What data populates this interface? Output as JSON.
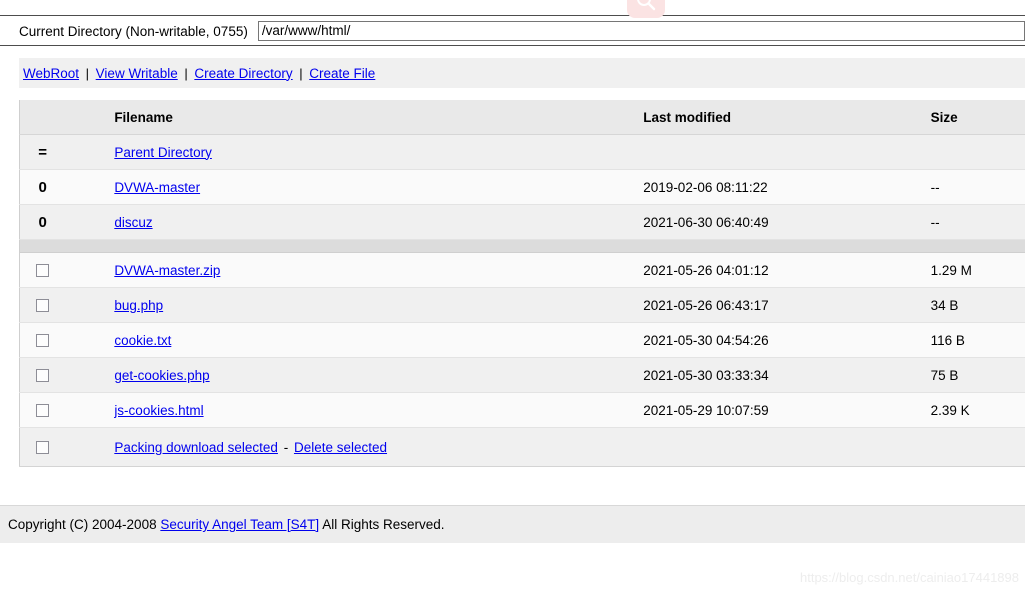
{
  "topbar": {
    "search_icon": "search-icon",
    "chip_color": "#fbe3e3"
  },
  "directory": {
    "label": "Current Directory (Non-writable, 0755)",
    "path_value": "/var/www/html/",
    "path_placeholder": "/var/www/html/"
  },
  "nav": {
    "links": [
      {
        "label": "WebRoot"
      },
      {
        "label": "View Writable"
      },
      {
        "label": "Create Directory"
      },
      {
        "label": "Create File"
      }
    ],
    "separator": "|"
  },
  "table": {
    "headers": {
      "icon": "",
      "filename": "Filename",
      "last_modified": "Last modified",
      "size": "Size"
    },
    "dir_rows": [
      {
        "icon": "=",
        "icon_name": "parent-directory-icon",
        "name": "Parent Directory",
        "last_modified": "",
        "size": ""
      },
      {
        "icon": "0",
        "icon_name": "folder-icon",
        "name": "DVWA-master",
        "last_modified": "2019-02-06 08:11:22",
        "size": "--"
      },
      {
        "icon": "0",
        "icon_name": "folder-icon",
        "name": "discuz",
        "last_modified": "2021-06-30 06:40:49",
        "size": "--"
      }
    ],
    "file_rows": [
      {
        "name": "DVWA-master.zip",
        "last_modified": "2021-05-26 04:01:12",
        "size": "1.29 M",
        "checked": false
      },
      {
        "name": "bug.php",
        "last_modified": "2021-05-26 06:43:17",
        "size": "34 B",
        "checked": false
      },
      {
        "name": "cookie.txt",
        "last_modified": "2021-05-30 04:54:26",
        "size": "116 B",
        "checked": false
      },
      {
        "name": "get-cookies.php",
        "last_modified": "2021-05-30 03:33:34",
        "size": "75 B",
        "checked": false
      },
      {
        "name": "js-cookies.html",
        "last_modified": "2021-05-29 10:07:59",
        "size": "2.39 K",
        "checked": false
      }
    ],
    "actions": {
      "packing_download": "Packing download selected",
      "dash": "-",
      "delete_selected": "Delete selected",
      "select_all_checked": false
    }
  },
  "footer": {
    "prefix": "Copyright (C) 2004-2008 ",
    "link": "Security Angel Team [S4T]",
    "suffix": " All Rights Reserved."
  },
  "watermark": {
    "text": "https://blog.csdn.net/cainiao17441898"
  },
  "colors": {
    "link": "#0000ee",
    "header_bg": "#e9e9e9",
    "row_odd": "#f0f0f0",
    "row_even": "#fafafa",
    "spacer": "#dcdcdc",
    "footer_bg": "#ededed"
  }
}
